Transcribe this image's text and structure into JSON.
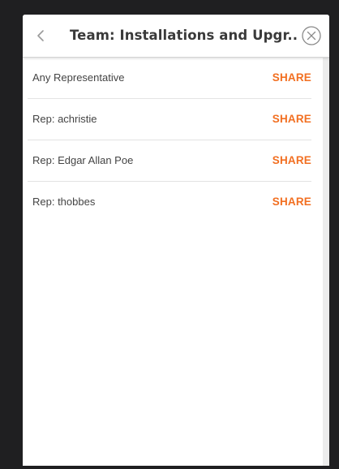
{
  "header": {
    "title": "Team: Installations and Upgr..."
  },
  "share_label": "SHARE",
  "items": [
    {
      "label": "Any Representative"
    },
    {
      "label": "Rep: achristie"
    },
    {
      "label": "Rep: Edgar Allan Poe"
    },
    {
      "label": "Rep: thobbes"
    }
  ],
  "colors": {
    "accent": "#f26f21",
    "background": "#1f1f21",
    "panel": "#ffffff"
  }
}
